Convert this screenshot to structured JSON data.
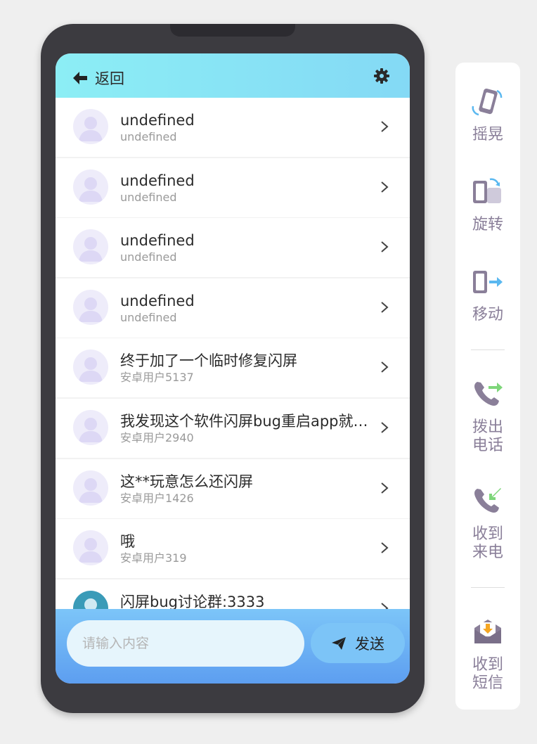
{
  "header": {
    "back_label": "返回"
  },
  "messages": [
    {
      "title": "undefined",
      "author": "undefined"
    },
    {
      "title": "undefined",
      "author": "undefined"
    },
    {
      "title": "undefined",
      "author": "undefined"
    },
    {
      "title": "undefined",
      "author": "undefined"
    },
    {
      "title": "终于加了一个临时修复闪屏",
      "author": "安卓用户5137"
    },
    {
      "title": "我发现这个软件闪屏bug重启app就好了",
      "author": "安卓用户2940"
    },
    {
      "title": "这**玩意怎么还闪屏",
      "author": "安卓用户1426"
    },
    {
      "title": "哦",
      "author": "安卓用户319"
    },
    {
      "title": "闪屏bug讨论群:3333",
      "author": ""
    }
  ],
  "composer": {
    "placeholder": "请输入内容",
    "send_label": "发送"
  },
  "tools": {
    "shake": "摇晃",
    "rotate": "旋转",
    "move": "移动",
    "call_out": [
      "拨出",
      "电话"
    ],
    "call_in": [
      "收到",
      "来电"
    ],
    "sms": [
      "收到",
      "短信"
    ]
  },
  "colors": {
    "header_gradient": [
      "#8ceef5",
      "#84d9f5"
    ],
    "footer_gradient": [
      "#7cc5f8",
      "#5d9ef0"
    ],
    "tool_label": "#8a7f99",
    "accent_blue": "#5ab8f0",
    "accent_green": "#7ed67a"
  }
}
